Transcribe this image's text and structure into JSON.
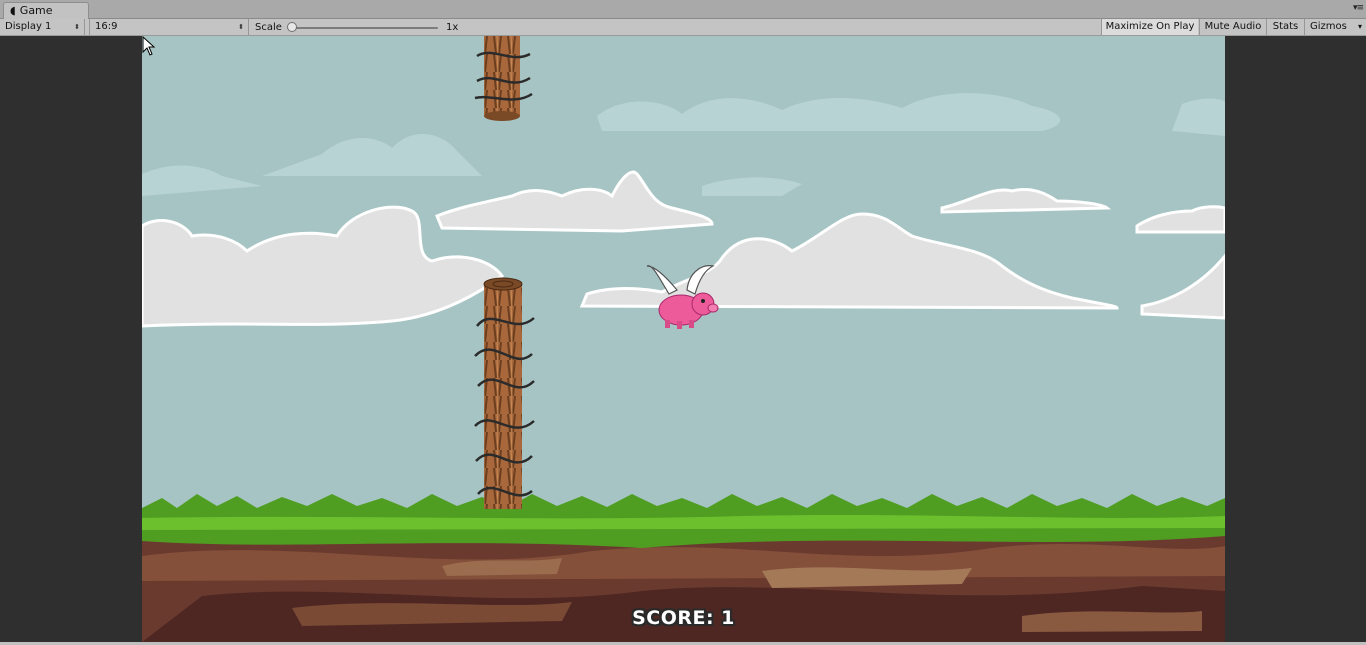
{
  "window": {
    "tab_title": "Game",
    "tab_icon": "pacman-icon",
    "tab_menu_glyph": "▾≡"
  },
  "toolbar": {
    "display": "Display 1",
    "aspect": "16:9",
    "scale_label": "Scale",
    "scale_value": "1x",
    "scale_fraction": 0.0,
    "maximize_on_play": "Maximize On Play",
    "mute_audio": "Mute Audio",
    "stats": "Stats",
    "gizmos": "Gizmos",
    "dropdown_glyph": "⬍",
    "gizmos_arrow": "▾"
  },
  "game": {
    "score_text": "SCORE: 1",
    "colors": {
      "sky": "#a6c4c4",
      "cloud": "#e1e1e1",
      "grass": "#4f9e22",
      "dirt": "#6b3a2e",
      "pig": "#ee5b9a"
    }
  }
}
